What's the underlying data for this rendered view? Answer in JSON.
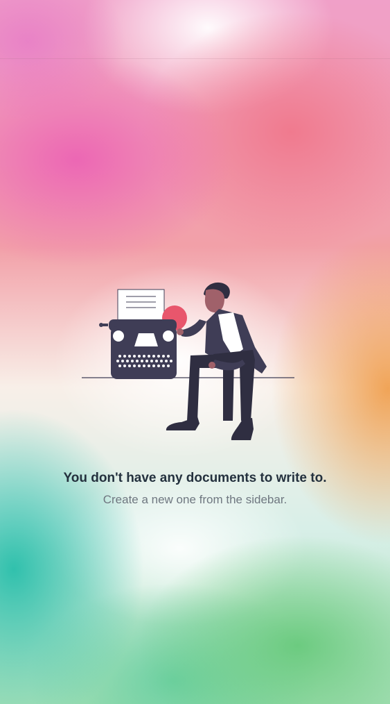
{
  "empty_state": {
    "title": "You don't have any documents to write to.",
    "subtitle": "Create a new one from the sidebar.",
    "illustration_icon": "person-with-typewriter-illustration"
  },
  "colors": {
    "title": "#24313e",
    "subtitle": "#6f7780",
    "illustration_dark": "#3f3d56",
    "illustration_accent": "#e8566c",
    "skin": "#a0616a"
  }
}
